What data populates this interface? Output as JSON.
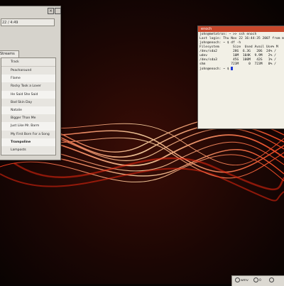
{
  "player": {
    "close_glyph": "×",
    "progress_text": "22 / 4:49",
    "tab_label": "Streams",
    "column_track": "Track",
    "tracks": [
      "Peacharound",
      "Flame",
      "Rocky Took a Lover",
      "He Said She Said",
      "Bad Skin Day",
      "Natalie",
      "Bigger Than Me",
      "Just Like Mr. Barm",
      "My First Born For a Song",
      "Trampoline",
      "Lamposts"
    ],
    "current_track": "Trampoline"
  },
  "terminal": {
    "title": "enoch",
    "lines": [
      "john@metatron: ~ >> ssh enoch",
      "Last login: Thu Nov 22 16:44:35 2007 from met",
      "john@enoch: ~ $ df -h",
      "Filesystem       Size  Used Avail Use% M",
      "/dev/sda2        28G  6.3G   20G  24% /",
      "udev             10M  104K  9.9M   2% /",
      "/dev/sda3        45G  100M   42G   1% /",
      "shm             723M     0  723M   0% /"
    ],
    "prompt": "john@enoch: ~ $ "
  },
  "panel": {
    "item1": "wmv",
    "item2": "0"
  },
  "colors": {
    "background": "#090403",
    "terminal_titlebar": "#c8482c",
    "cursor": "#1f3bd6"
  }
}
